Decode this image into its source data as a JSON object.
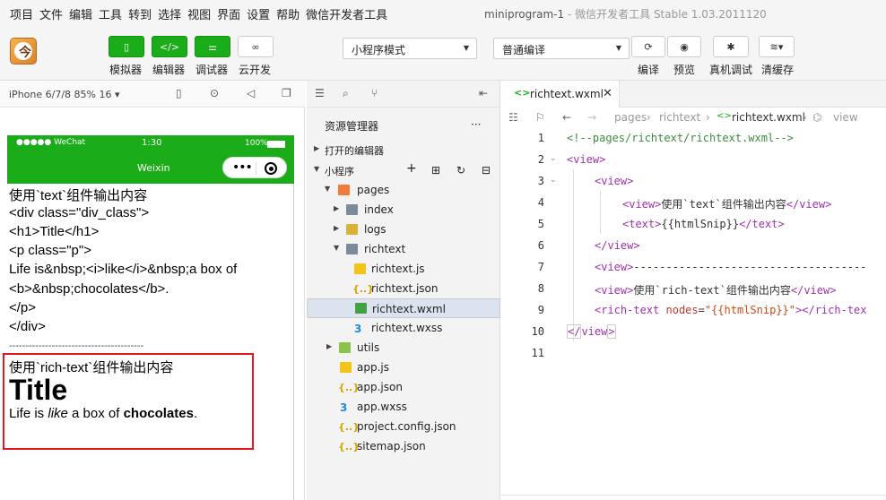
{
  "menubar": {
    "items": [
      "项目",
      "文件",
      "编辑",
      "工具",
      "转到",
      "选择",
      "视图",
      "界面",
      "设置",
      "帮助",
      "微信开发者工具"
    ],
    "title": "miniprogram-1",
    "title_sep": " - ",
    "version": "微信开发者工具 Stable 1.03.2011120"
  },
  "toolbar": {
    "simulator": "模拟器",
    "editor": "编辑器",
    "debugger": "调试器",
    "cloud": "云开发",
    "mode_select": "小程序模式",
    "compile_select": "普通编译",
    "compile": "编译",
    "preview": "预览",
    "remote_debug": "真机调试",
    "clear_cache": "清缓存",
    "colors": {
      "green": "#1aad19"
    }
  },
  "simulator": {
    "device": "iPhone 6/7/8 85% 16 ▾",
    "status": {
      "carrier": "●●●●● WeChat",
      "time": "1:30",
      "battery": "100%"
    },
    "nav_title": "Weixin",
    "content": {
      "line1": "使用`text`组件输出内容",
      "line2": "<div class=\"div_class\">",
      "line3": "<h1>Title</h1>",
      "line4": "<p class=\"p\">",
      "line5": "Life is&nbsp;<i>like</i>&nbsp;a box of",
      "line6": "<b>&nbsp;chocolates</b>.",
      "line7": "</p>",
      "line8": "</div>",
      "divider": "-----------------------------------------",
      "rt_label": "使用`rich-text`组件输出内容",
      "rt_title": "Title",
      "rt_p1": "Life is ",
      "rt_italic": "like",
      "rt_p2": " a box of ",
      "rt_bold": "chocolates",
      "rt_p3": "."
    }
  },
  "explorer": {
    "title": "资源管理器",
    "more": "···",
    "open_editors": "打开的编辑器",
    "project": "小程序",
    "items": [
      {
        "label": "pages"
      },
      {
        "label": "index"
      },
      {
        "label": "logs"
      },
      {
        "label": "richtext"
      },
      {
        "label": "richtext.js"
      },
      {
        "label": "richtext.json"
      },
      {
        "label": "richtext.wxml"
      },
      {
        "label": "richtext.wxss"
      },
      {
        "label": "utils"
      },
      {
        "label": "app.js"
      },
      {
        "label": "app.json"
      },
      {
        "label": "app.wxss"
      },
      {
        "label": "project.config.json"
      },
      {
        "label": "sitemap.json"
      }
    ]
  },
  "editor": {
    "tab": "richtext.wxml",
    "close": "✕",
    "breadcrumb": [
      "pages",
      "richtext",
      "richtext.wxml",
      "view"
    ],
    "line_numbers": [
      "1",
      "2",
      "3",
      "4",
      "5",
      "6",
      "7",
      "8",
      "9",
      "10",
      "11"
    ],
    "code": {
      "l1": "<!--pages/richtext/richtext.wxml-->",
      "l2": "view",
      "l3": "view",
      "l4a": "view",
      "l4b": "使用`text`组件输出内容",
      "l4c": "view",
      "l5a": "text",
      "l5b": "{{htmlSnip}}",
      "l5c": "text",
      "l6": "view",
      "l7a": "view",
      "l7b": "------------------------------------",
      "l8a": "view",
      "l8b": "使用`rich-text`组件输出内容",
      "l8c": "view",
      "l9a": "rich-text",
      "l9b": "nodes",
      "l9c": "\"{{htmlSnip}}\"",
      "l9d": "rich-tex",
      "l10": "view"
    }
  }
}
